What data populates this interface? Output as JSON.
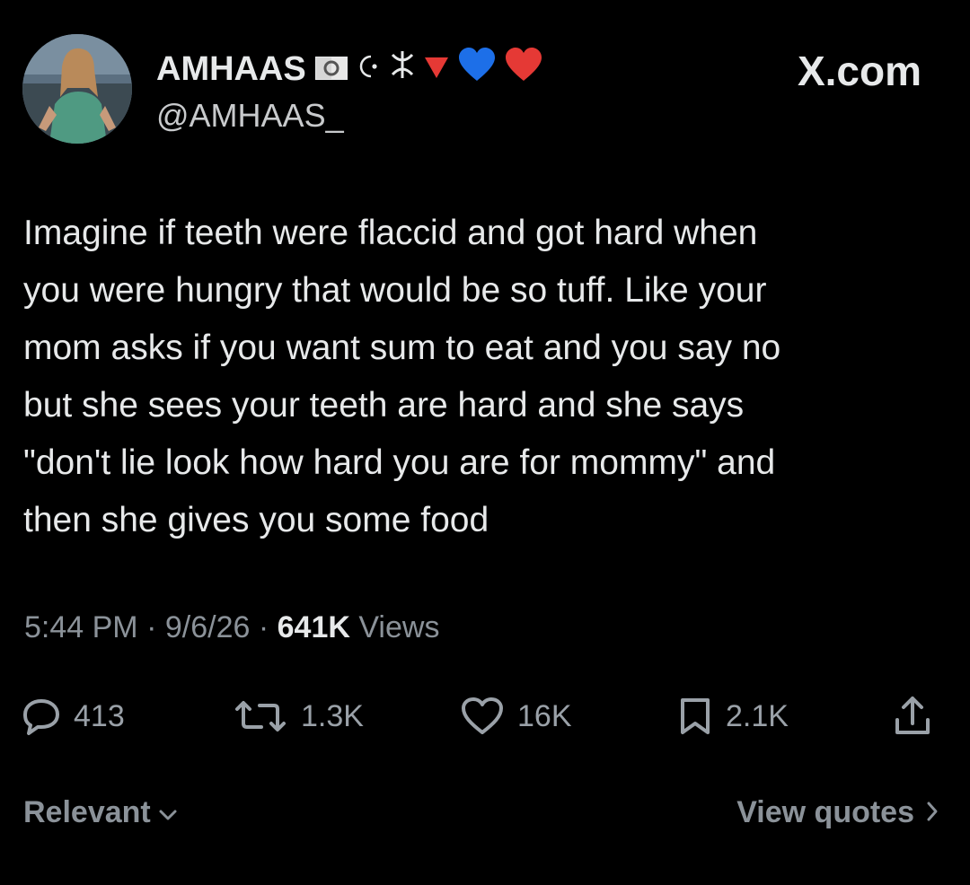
{
  "author": {
    "display_name": "AMHAAS",
    "handle": "@AMHAAS_",
    "badges": [
      "algeria-flag-icon",
      "crescent-star-icon",
      "amazigh-symbol-icon",
      "red-triangle-icon",
      "blue-heart-icon",
      "red-heart-icon"
    ]
  },
  "brand": "X.com",
  "tweet": {
    "text": "Imagine if teeth were flaccid and got hard when\nyou were hungry that would be so tuff. Like your\nmom asks if you want sum to eat and you say no\nbut she sees your teeth are hard and she says\n\"don't lie look how hard you are for mommy\" and\nthen she gives you some food"
  },
  "meta": {
    "time": "5:44 PM",
    "date": "9/6/26",
    "views_count": "641K",
    "views_label": "Views"
  },
  "actions": {
    "replies": "413",
    "reposts": "1.3K",
    "likes": "16K",
    "bookmarks": "2.1K"
  },
  "footer": {
    "sort_label": "Relevant",
    "quotes_label": "View quotes"
  },
  "colors": {
    "background": "#000000",
    "text": "#e7e9ea",
    "secondary": "#8b9299",
    "red": "#e53935",
    "blue": "#1d6fe8"
  }
}
